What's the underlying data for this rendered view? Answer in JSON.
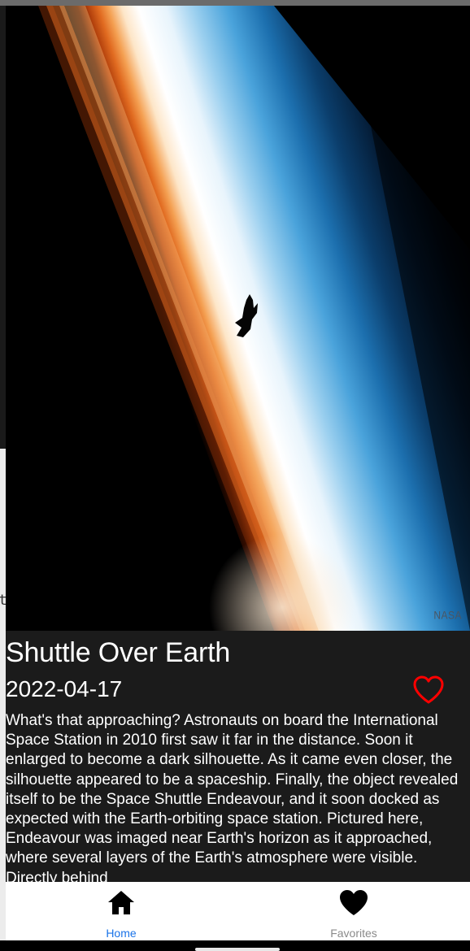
{
  "hero": {
    "watermark": "NASA"
  },
  "article": {
    "title": "Shuttle Over Earth",
    "date": "2022-04-17",
    "description": "What's that approaching? Astronauts on board the International Space Station in 2010 first saw it far in the distance.  Soon it enlarged to become a dark silhouette.  As it came even closer, the silhouette appeared to be a spaceship. Finally, the object revealed itself to be the Space Shuttle Endeavour, and it soon docked as expected with the Earth-orbiting space station.  Pictured here, Endeavour was imaged near Earth's horizon as it approached, where several layers of the Earth's atmosphere were visible. Directly behind"
  },
  "edge_text": "t",
  "favorite": {
    "icon": "heart-outline-icon",
    "color": "#ff0000"
  },
  "tabs": [
    {
      "label": "Home",
      "icon": "home-icon",
      "active": true,
      "color": "#1a73e8"
    },
    {
      "label": "Favorites",
      "icon": "heart-icon",
      "active": false,
      "color": "#8a8a8a"
    }
  ]
}
